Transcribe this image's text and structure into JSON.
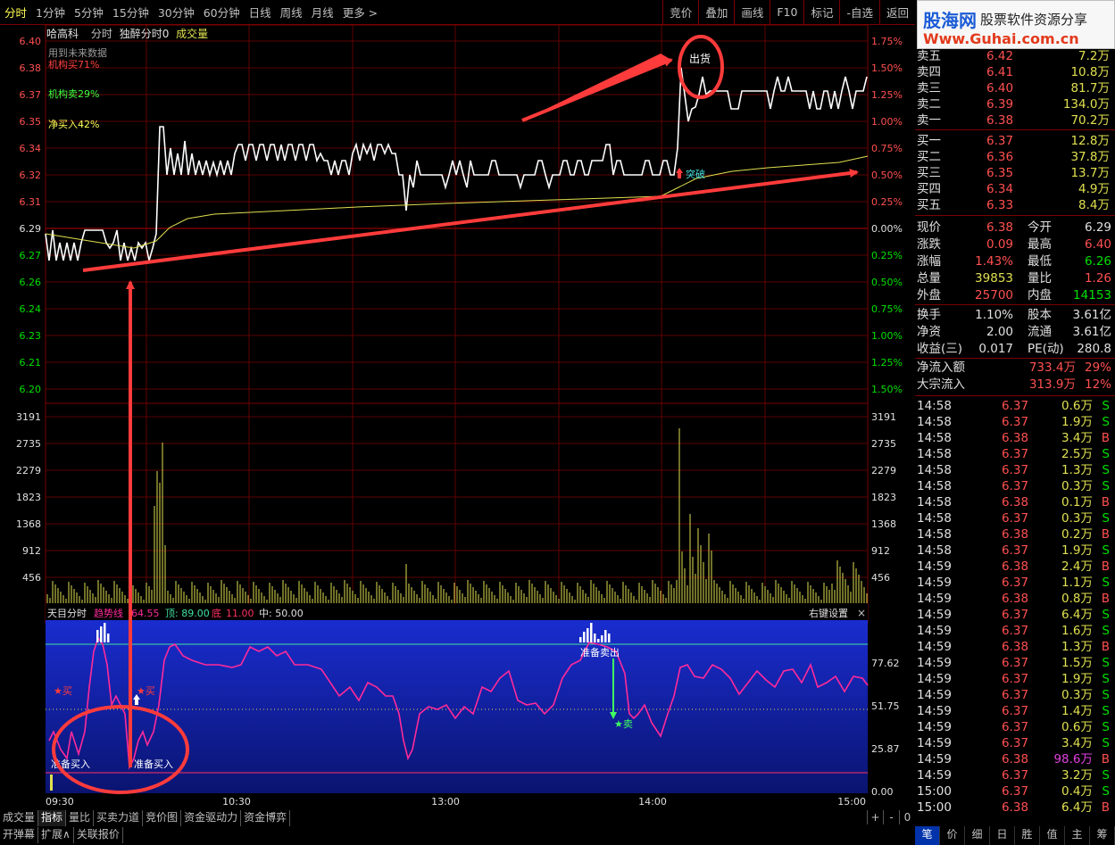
{
  "topbar": {
    "tabs": [
      "分时",
      "1分钟",
      "5分钟",
      "15分钟",
      "30分钟",
      "60分钟",
      "日线",
      "周线",
      "月线",
      "更多 >"
    ],
    "tools": [
      "竞价",
      "叠加",
      "画线",
      "F10",
      "标记",
      "-自选",
      "返回"
    ]
  },
  "logo": {
    "brand": "股海网",
    "slogan": "股票软件资源分享",
    "url": "Www.Guhai.com.cn"
  },
  "stock": {
    "name": "哈高科",
    "mode": "分时",
    "indicator": "独醉分时0",
    "volume_label": "成交量"
  },
  "legend": {
    "future": "用到未来数据",
    "inst_buy": "机构买71%",
    "inst_sell": "机构卖29%",
    "net_buy": "净买入42%"
  },
  "annotations": {
    "sell": "出货",
    "breakout": "突破"
  },
  "price_axis": [
    "6.40",
    "6.38",
    "6.37",
    "6.35",
    "6.34",
    "6.32",
    "6.31",
    "6.29",
    "6.27",
    "6.26",
    "6.24",
    "6.23",
    "6.21",
    "6.20"
  ],
  "pct_axis": [
    "1.75%",
    "1.50%",
    "1.25%",
    "1.00%",
    "0.75%",
    "0.50%",
    "0.25%",
    "0.00%",
    "0.25%",
    "0.50%",
    "0.75%",
    "1.00%",
    "1.25%",
    "1.50%"
  ],
  "vol_axis": [
    "3191",
    "2735",
    "2279",
    "1823",
    "1368",
    "912",
    "456"
  ],
  "osc": {
    "title": "天目分时",
    "trend": "趋势线",
    "trend_val": "64.55",
    "top": "顶: 89.00",
    "bottom_label": "底",
    "bottom_val": "11.00",
    "mid": "中: 50.00",
    "settings": "右键设置",
    "close": "×",
    "axis": [
      "77.62",
      "51.75",
      "25.87",
      "0.00"
    ],
    "buy1": "★买",
    "buy2": "★买",
    "sell": "★卖",
    "ready_buy1": "准备买入",
    "ready_buy2": "准备买入",
    "ready_sell": "准备卖出"
  },
  "time_axis": [
    "09:30",
    "10:30",
    "13:00",
    "14:00",
    "15:00"
  ],
  "quotes": {
    "sell": [
      {
        "label": "卖五",
        "price": "6.42",
        "vol": "7.2万"
      },
      {
        "label": "卖四",
        "price": "6.41",
        "vol": "10.8万"
      },
      {
        "label": "卖三",
        "price": "6.40",
        "vol": "81.7万"
      },
      {
        "label": "卖二",
        "price": "6.39",
        "vol": "134.0万"
      },
      {
        "label": "卖一",
        "price": "6.38",
        "vol": "70.2万"
      }
    ],
    "buy": [
      {
        "label": "买一",
        "price": "6.37",
        "vol": "12.8万"
      },
      {
        "label": "买二",
        "price": "6.36",
        "vol": "37.8万"
      },
      {
        "label": "买三",
        "price": "6.35",
        "vol": "13.7万"
      },
      {
        "label": "买四",
        "price": "6.34",
        "vol": "4.9万"
      },
      {
        "label": "买五",
        "price": "6.33",
        "vol": "8.4万"
      }
    ]
  },
  "stats": [
    {
      "k1": "现价",
      "v1": "6.38",
      "c1": "#ff5050",
      "k2": "今开",
      "v2": "6.29",
      "c2": "#e0e0e0"
    },
    {
      "k1": "涨跌",
      "v1": "0.09",
      "c1": "#ff5050",
      "k2": "最高",
      "v2": "6.40",
      "c2": "#ff5050"
    },
    {
      "k1": "涨幅",
      "v1": "1.43%",
      "c1": "#ff5050",
      "k2": "最低",
      "v2": "6.26",
      "c2": "#00e000"
    },
    {
      "k1": "总量",
      "v1": "39853",
      "c1": "#e0e050",
      "k2": "量比",
      "v2": "1.26",
      "c2": "#ff5050"
    },
    {
      "k1": "外盘",
      "v1": "25700",
      "c1": "#ff5050",
      "k2": "内盘",
      "v2": "14153",
      "c2": "#00e000"
    }
  ],
  "stats2": [
    {
      "k1": "换手",
      "v1": "1.10%",
      "k2": "股本",
      "v2": "3.61亿"
    },
    {
      "k1": "净资",
      "v1": "2.00",
      "k2": "流通",
      "v2": "3.61亿"
    },
    {
      "k1": "收益(三)",
      "v1": "0.017",
      "k2": "PE(动)",
      "v2": "280.8"
    }
  ],
  "flows": [
    {
      "label": "净流入额",
      "value": "733.4万",
      "pct": "29%"
    },
    {
      "label": "大宗流入",
      "value": "313.9万",
      "pct": "12%"
    }
  ],
  "ticks": [
    {
      "t": "14:58",
      "p": "6.37",
      "v": "0.6万",
      "d": "S"
    },
    {
      "t": "14:58",
      "p": "6.37",
      "v": "1.9万",
      "d": "S"
    },
    {
      "t": "14:58",
      "p": "6.38",
      "v": "3.4万",
      "d": "B"
    },
    {
      "t": "14:58",
      "p": "6.37",
      "v": "2.5万",
      "d": "S"
    },
    {
      "t": "14:58",
      "p": "6.37",
      "v": "1.3万",
      "d": "S"
    },
    {
      "t": "14:58",
      "p": "6.37",
      "v": "0.3万",
      "d": "S"
    },
    {
      "t": "14:58",
      "p": "6.38",
      "v": "0.1万",
      "d": "B"
    },
    {
      "t": "14:58",
      "p": "6.37",
      "v": "0.3万",
      "d": "S"
    },
    {
      "t": "14:58",
      "p": "6.38",
      "v": "0.2万",
      "d": "B"
    },
    {
      "t": "14:58",
      "p": "6.37",
      "v": "1.9万",
      "d": "S"
    },
    {
      "t": "14:59",
      "p": "6.38",
      "v": "2.4万",
      "d": "B"
    },
    {
      "t": "14:59",
      "p": "6.37",
      "v": "1.1万",
      "d": "S"
    },
    {
      "t": "14:59",
      "p": "6.38",
      "v": "0.8万",
      "d": "B"
    },
    {
      "t": "14:59",
      "p": "6.37",
      "v": "6.4万",
      "d": "S"
    },
    {
      "t": "14:59",
      "p": "6.37",
      "v": "1.6万",
      "d": "S"
    },
    {
      "t": "14:59",
      "p": "6.38",
      "v": "1.3万",
      "d": "B"
    },
    {
      "t": "14:59",
      "p": "6.37",
      "v": "1.5万",
      "d": "S"
    },
    {
      "t": "14:59",
      "p": "6.37",
      "v": "1.9万",
      "d": "S"
    },
    {
      "t": "14:59",
      "p": "6.37",
      "v": "0.3万",
      "d": "S"
    },
    {
      "t": "14:59",
      "p": "6.37",
      "v": "1.4万",
      "d": "S"
    },
    {
      "t": "14:59",
      "p": "6.37",
      "v": "0.6万",
      "d": "S"
    },
    {
      "t": "14:59",
      "p": "6.37",
      "v": "3.4万",
      "d": "S"
    },
    {
      "t": "14:59",
      "p": "6.38",
      "v": "98.6万",
      "d": "B"
    },
    {
      "t": "14:59",
      "p": "6.37",
      "v": "3.2万",
      "d": "S"
    },
    {
      "t": "15:00",
      "p": "6.37",
      "v": "0.4万",
      "d": "S"
    },
    {
      "t": "15:00",
      "p": "6.38",
      "v": "6.4万",
      "d": "B"
    }
  ],
  "bottom_tabs": [
    "成交量",
    "指标",
    "量比",
    "买卖力道",
    "竞价图",
    "资金驱动力",
    "资金博弈"
  ],
  "bottom_tabs2": [
    "开弹幕",
    "扩展∧",
    "关联报价"
  ],
  "bottom_controls": [
    "+",
    "-",
    "0"
  ],
  "right_tabs": [
    "笔",
    "价",
    "细",
    "日",
    "胜",
    "值",
    "主",
    "筹"
  ],
  "colors": {
    "up": "#ff5050",
    "down": "#00e000",
    "grid": "#7a0000",
    "price_line": "#ffffff",
    "avg_line": "#e0e050",
    "osc_bg": "#1b2bd0",
    "osc_line": "#ff2a9a",
    "arrow": "#ff3b3b"
  }
}
